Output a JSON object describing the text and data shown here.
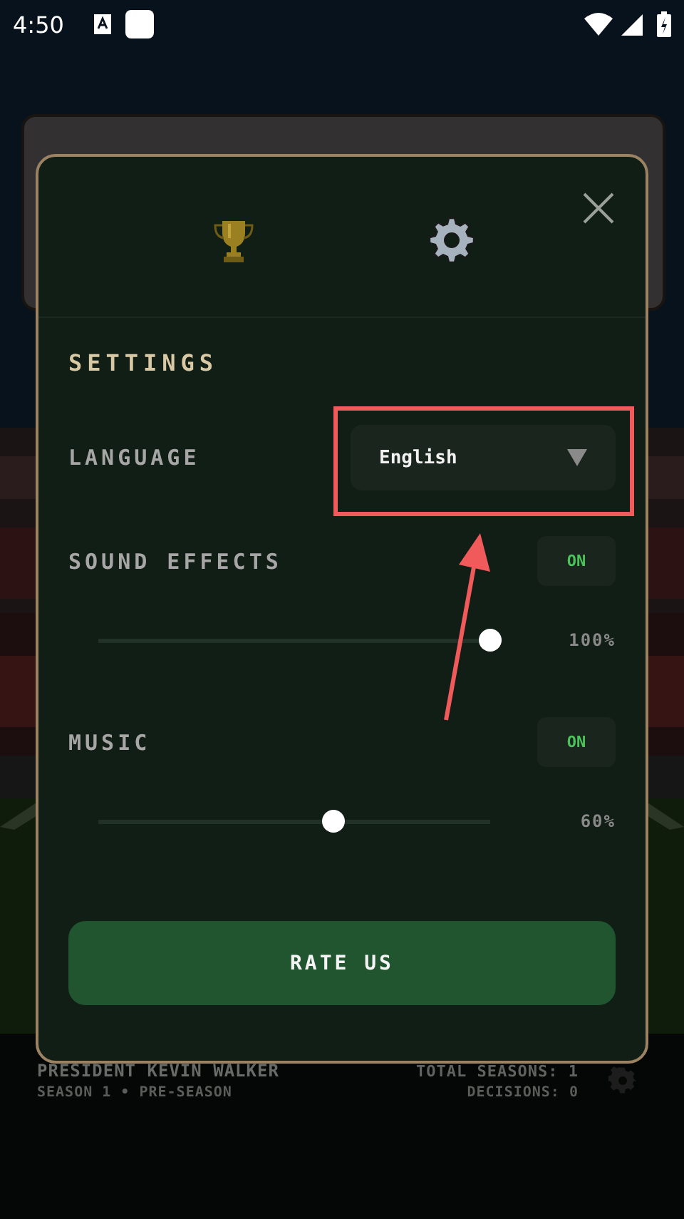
{
  "status_bar": {
    "time": "4:50"
  },
  "background": {
    "president": "PRESIDENT KEVIN WALKER",
    "total_seasons": "TOTAL SEASONS: 1",
    "season": "SEASON 1 • PRE-SEASON",
    "decisions": "DECISIONS: 0"
  },
  "dialog": {
    "title": "SETTINGS",
    "language": {
      "label": "LANGUAGE",
      "value": "English"
    },
    "settings": [
      {
        "label": "SOUND EFFECTS",
        "on": true,
        "toggle": "ON",
        "level": 1.0,
        "reading": "100%"
      },
      {
        "label": "MUSIC",
        "on": true,
        "toggle": "ON",
        "level": 0.6,
        "reading": "60%"
      }
    ],
    "rate_button": "RATE US"
  }
}
